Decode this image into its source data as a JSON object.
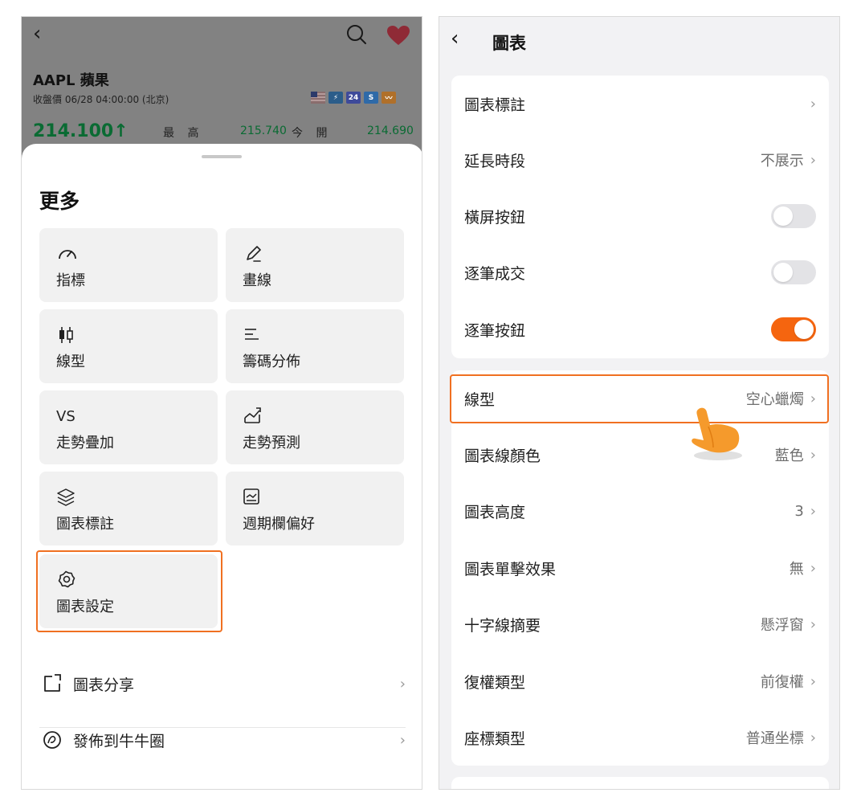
{
  "left": {
    "header": {
      "stock_code": "AAPL  蘋果",
      "close_time": "收盤價 06/28 04:00:00 (北京)",
      "price": "214.100↑",
      "high_label": "最 高",
      "high_value": "215.740",
      "open_label": "今 開",
      "open_value": "214.690",
      "badge_24": "24",
      "badge_s": "S"
    },
    "sheet": {
      "title": "更多",
      "tiles": [
        {
          "label": "指標",
          "icon": "speedometer-icon"
        },
        {
          "label": "畫線",
          "icon": "pen-icon"
        },
        {
          "label": "線型",
          "icon": "candlestick-icon"
        },
        {
          "label": "籌碼分佈",
          "icon": "bars-distribution-icon"
        },
        {
          "label": "走勢疊加",
          "icon": "vs-text-icon",
          "icon_text": "VS"
        },
        {
          "label": "走勢預測",
          "icon": "trend-predict-icon"
        },
        {
          "label": "圖表標註",
          "icon": "layers-icon"
        },
        {
          "label": "週期欄偏好",
          "icon": "chart-frame-icon"
        },
        {
          "label": "圖表設定",
          "icon": "gear-icon"
        }
      ],
      "rows": [
        {
          "label": "圖表分享",
          "icon": "share-icon"
        },
        {
          "label": "發佈到牛牛圈",
          "icon": "community-icon"
        }
      ]
    }
  },
  "right": {
    "title": "圖表",
    "card1": [
      {
        "label": "圖表標註",
        "value": ""
      },
      {
        "label": "延長時段",
        "value": "不展示"
      },
      {
        "label": "橫屏按鈕",
        "toggle": false
      },
      {
        "label": "逐筆成交",
        "toggle": false
      },
      {
        "label": "逐筆按鈕",
        "toggle": true
      }
    ],
    "card2": [
      {
        "label": "線型",
        "value": "空心蠟燭"
      },
      {
        "label": "圖表線顏色",
        "value": "藍色"
      },
      {
        "label": "圖表高度",
        "value": "3"
      },
      {
        "label": "圖表單擊效果",
        "value": "無"
      },
      {
        "label": "十字線摘要",
        "value": "懸浮窗"
      },
      {
        "label": "復權類型",
        "value": "前復權"
      },
      {
        "label": "座標類型",
        "value": "普通坐標"
      }
    ]
  },
  "colors": {
    "accent": "#f07021",
    "toggle_on": "#f5650f",
    "price_green": "#0a6b33",
    "heart": "#c0392b"
  }
}
